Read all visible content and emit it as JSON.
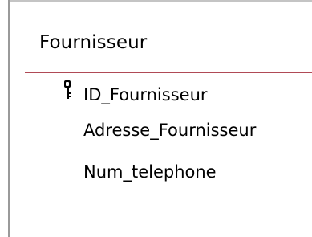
{
  "table": {
    "name": "Fournisseur",
    "fields": [
      {
        "label": "ID_Fournisseur",
        "icon": "primary-key-icon",
        "is_primary_key": true
      },
      {
        "label": "Adresse_Fournisseur",
        "icon": "",
        "is_primary_key": false
      },
      {
        "label": "Num_telephone",
        "icon": "",
        "is_primary_key": false
      }
    ]
  },
  "colors": {
    "header_rule": "#b04a56"
  }
}
